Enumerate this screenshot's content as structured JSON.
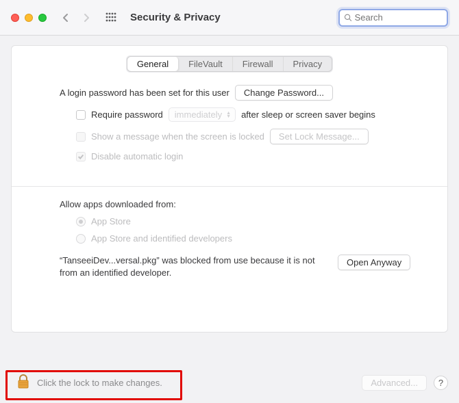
{
  "window": {
    "title": "Security & Privacy"
  },
  "search": {
    "placeholder": "Search"
  },
  "tabs": {
    "general": "General",
    "filevault": "FileVault",
    "firewall": "Firewall",
    "privacy": "Privacy"
  },
  "general": {
    "login_set": "A login password has been set for this user",
    "change_password": "Change Password...",
    "require_password": "Require password",
    "immediately": "immediately",
    "after_sleep": "after sleep or screen saver begins",
    "show_message": "Show a message when the screen is locked",
    "set_lock_message": "Set Lock Message...",
    "disable_auto_login": "Disable automatic login"
  },
  "downloads": {
    "heading": "Allow apps downloaded from:",
    "opt1": "App Store",
    "opt2": "App Store and identified developers",
    "blocked": "“TanseeiDev...versal.pkg” was blocked from use because it is not from an identified developer.",
    "open_anyway": "Open Anyway"
  },
  "footer": {
    "lock_text": "Click the lock to make changes.",
    "advanced": "Advanced...",
    "help": "?"
  }
}
